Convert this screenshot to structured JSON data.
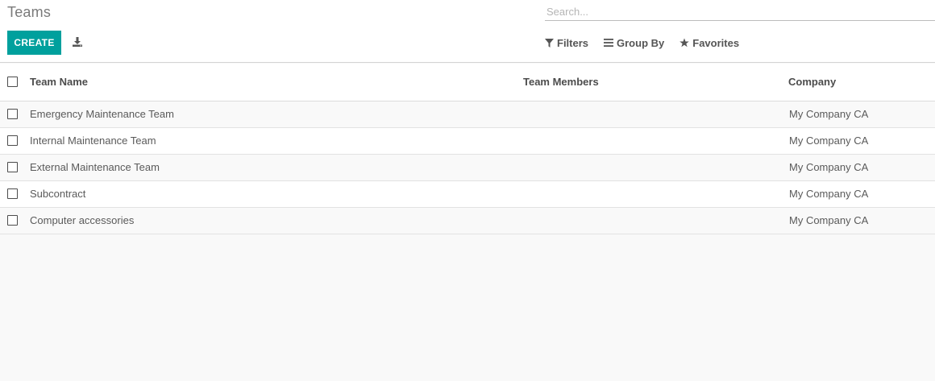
{
  "header": {
    "title": "Teams",
    "search_placeholder": "Search...",
    "create_label": "CREATE",
    "download_icon": "download-icon",
    "filters_label": "Filters",
    "group_by_label": "Group By",
    "favorites_label": "Favorites"
  },
  "table": {
    "columns": [
      "Team Name",
      "Team Members",
      "Company"
    ],
    "rows": [
      {
        "team_name": "Emergency Maintenance Team",
        "team_members": "",
        "company": "My Company CA"
      },
      {
        "team_name": "Internal Maintenance Team",
        "team_members": "",
        "company": "My Company CA"
      },
      {
        "team_name": "External Maintenance Team",
        "team_members": "",
        "company": "My Company CA"
      },
      {
        "team_name": "Subcontract",
        "team_members": "",
        "company": "My Company CA"
      },
      {
        "team_name": "Computer accessories",
        "team_members": "",
        "company": "My Company CA"
      }
    ]
  },
  "colors": {
    "accent": "#00a09d",
    "background": "#f9f9f9"
  }
}
